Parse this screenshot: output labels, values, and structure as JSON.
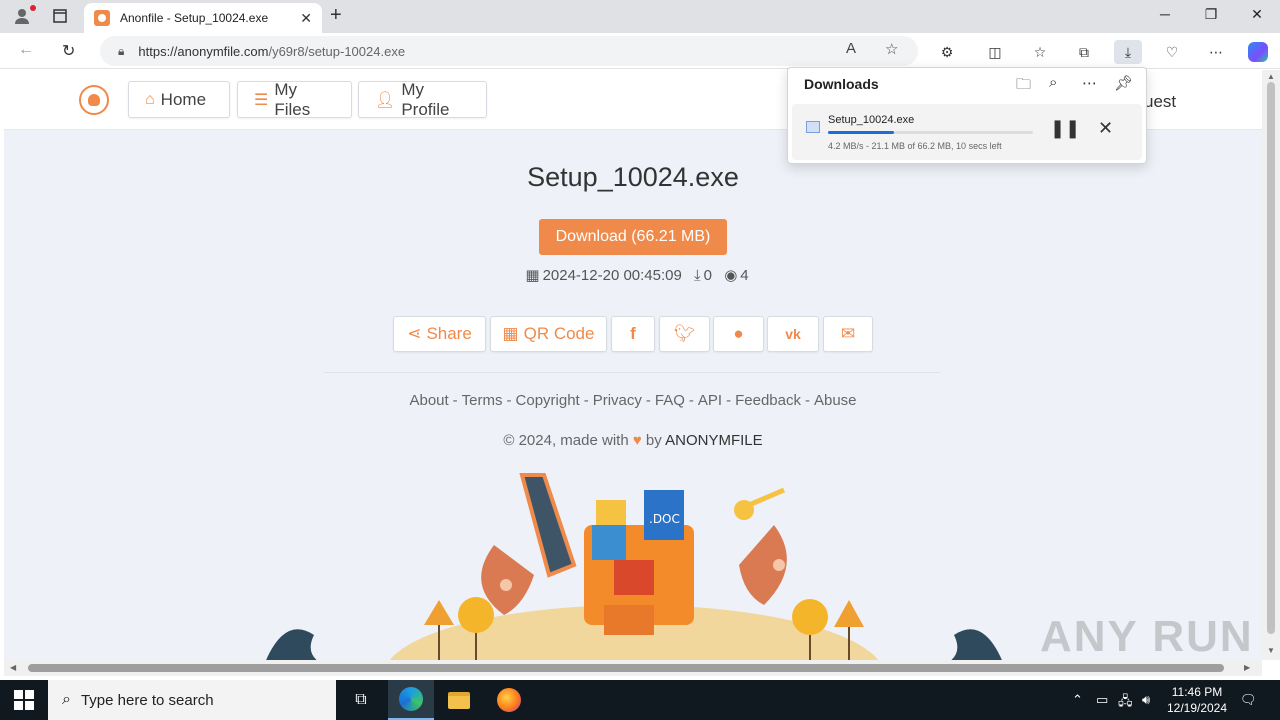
{
  "browser": {
    "tab_title": "Anonfile - Setup_10024.exe",
    "url_host": "https://anonymfile.com",
    "url_path": "/y69r8/setup-10024.exe"
  },
  "nav": {
    "home": "Home",
    "my_files": "My Files",
    "my_profile": "My Profile",
    "guest_partial": "uest"
  },
  "file": {
    "title": "Setup_10024.exe",
    "download_label": "Download (66.21 MB)",
    "date": "2024-12-20 00:45:09",
    "downloads": "0",
    "views": "4"
  },
  "share": {
    "share_label": "Share",
    "qr_label": "QR Code"
  },
  "footer": {
    "links": [
      "About",
      "Terms",
      "Copyright",
      "Privacy",
      "FAQ",
      "API",
      "Feedback",
      "Abuse"
    ],
    "copyright_prefix": "© 2024, made with",
    "copyright_by": "by",
    "brand": "ANONYMFILE"
  },
  "downloads_panel": {
    "title": "Downloads",
    "item_name": "Setup_10024.exe",
    "status": "4.2 MB/s - 21.1 MB of 66.2 MB, 10 secs left",
    "progress": 0.32
  },
  "taskbar": {
    "search_placeholder": "Type here to search",
    "time": "11:46 PM",
    "date": "12/19/2024"
  },
  "watermark": "ANY RUN",
  "colors": {
    "accent": "#f08a4b",
    "page_bg": "#eef2f8"
  }
}
